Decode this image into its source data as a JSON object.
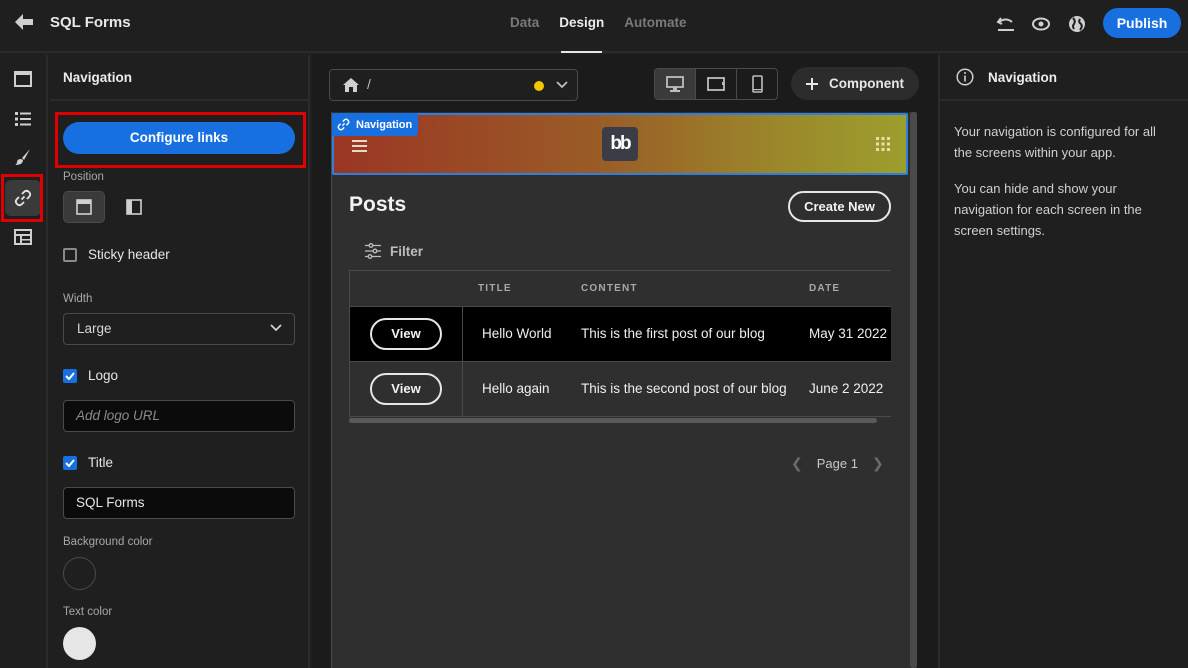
{
  "header": {
    "app_title": "SQL Forms",
    "tabs": [
      {
        "label": "Data",
        "active": false
      },
      {
        "label": "Design",
        "active": true
      },
      {
        "label": "Automate",
        "active": false
      }
    ],
    "publish_label": "Publish"
  },
  "rail": {
    "items": [
      "screens",
      "components",
      "theme",
      "navigation",
      "data"
    ],
    "active": "navigation"
  },
  "settings": {
    "title": "Navigation",
    "configure_links_label": "Configure links",
    "position_label": "Position",
    "position_options": [
      "top",
      "left"
    ],
    "position_selected": "top",
    "sticky_header_label": "Sticky header",
    "sticky_header_checked": false,
    "width_label": "Width",
    "width_value": "Large",
    "logo_label": "Logo",
    "logo_checked": true,
    "logo_url_placeholder": "Add logo URL",
    "title_label": "Title",
    "title_checked": true,
    "title_value": "SQL Forms",
    "background_color_label": "Background color",
    "background_color": "#1f1f1f",
    "text_color_label": "Text color",
    "text_color": "#e6e6e6"
  },
  "canvas": {
    "path": "/",
    "status_dot_color": "#f2c500",
    "device_selected": "desktop",
    "add_component_label": "Component",
    "nav_badge_label": "Navigation",
    "logo_text": "bb",
    "page_title": "Posts",
    "create_new_label": "Create New",
    "filter_label": "Filter",
    "table": {
      "columns": [
        "",
        "TITLE",
        "CONTENT",
        "DATE"
      ],
      "rows": [
        {
          "action": "View",
          "title": "Hello World",
          "content": "This is the first post of our blog",
          "date": "May 31 2022"
        },
        {
          "action": "View",
          "title": "Hello again",
          "content": "This is the second post of our blog",
          "date": "June 2 2022"
        }
      ]
    },
    "pagination": {
      "label": "Page 1"
    }
  },
  "info": {
    "title": "Navigation",
    "paragraphs": [
      "Your navigation is configured for all the screens within your app.",
      "You can hide and show your navigation for each screen in the screen settings."
    ]
  },
  "colors": {
    "accent": "#1870e0",
    "highlight": "#e00000"
  }
}
